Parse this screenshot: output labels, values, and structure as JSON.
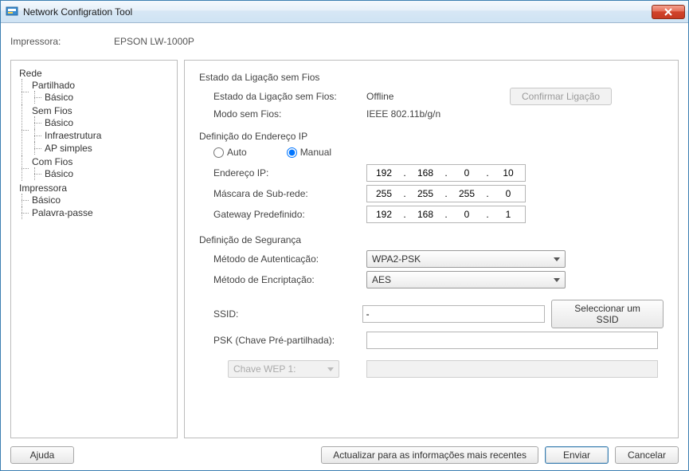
{
  "window": {
    "title": "Network Configration Tool"
  },
  "header": {
    "printer_label": "Impressora:",
    "printer_value": "EPSON LW-1000P"
  },
  "tree": {
    "rede": "Rede",
    "partilhado": "Partilhado",
    "partilhado_basico": "Básico",
    "sem_fios": "Sem Fios",
    "sf_basico": "Básico",
    "sf_infra": "Infraestrutura",
    "sf_ap": "AP simples",
    "com_fios": "Com Fios",
    "cf_basico": "Básico",
    "impressora": "Impressora",
    "imp_basico": "Básico",
    "imp_pass": "Palavra-passe"
  },
  "status": {
    "section": "Estado da Ligação sem Fios",
    "conn_label": "Estado da Ligação sem Fios:",
    "conn_value": "Offline",
    "mode_label": "Modo sem Fios:",
    "mode_value": "IEEE 802.11b/g/n",
    "confirm_btn": "Confirmar Ligação"
  },
  "ip": {
    "section": "Definição do Endereço IP",
    "auto": "Auto",
    "manual": "Manual",
    "addr_label": "Endereço IP:",
    "mask_label": "Máscara de Sub-rede:",
    "gw_label": "Gateway Predefinido:",
    "addr": {
      "a": "192",
      "b": "168",
      "c": "0",
      "d": "10"
    },
    "mask": {
      "a": "255",
      "b": "255",
      "c": "255",
      "d": "0"
    },
    "gw": {
      "a": "192",
      "b": "168",
      "c": "0",
      "d": "1"
    }
  },
  "sec": {
    "section": "Definição de Segurança",
    "auth_label": "Método de Autenticação:",
    "auth_value": "WPA2-PSK",
    "enc_label": "Método de Encriptação:",
    "enc_value": "AES",
    "ssid_label": "SSID:",
    "ssid_value": "-",
    "ssid_btn": "Seleccionar um SSID",
    "psk_label": "PSK (Chave Pré-partilhada):",
    "psk_value": "",
    "wep_label": "Chave WEP 1:",
    "wep_value": ""
  },
  "footer": {
    "help": "Ajuda",
    "refresh": "Actualizar para as informações mais recentes",
    "send": "Enviar",
    "cancel": "Cancelar"
  }
}
